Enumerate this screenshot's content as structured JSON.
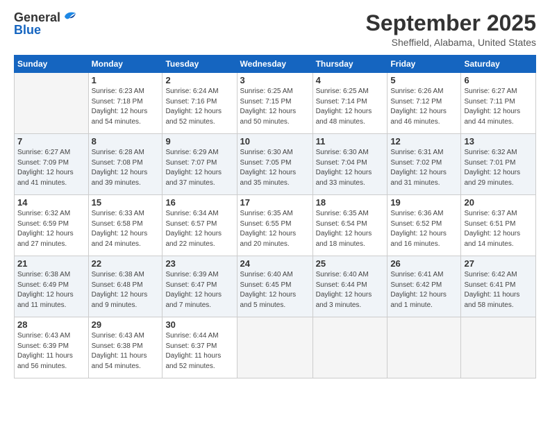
{
  "header": {
    "logo_general": "General",
    "logo_blue": "Blue",
    "month": "September 2025",
    "location": "Sheffield, Alabama, United States"
  },
  "weekdays": [
    "Sunday",
    "Monday",
    "Tuesday",
    "Wednesday",
    "Thursday",
    "Friday",
    "Saturday"
  ],
  "weeks": [
    [
      {
        "day": "",
        "empty": true
      },
      {
        "day": "1",
        "rise": "6:23 AM",
        "set": "7:18 PM",
        "hours": "12 hours and 54 minutes."
      },
      {
        "day": "2",
        "rise": "6:24 AM",
        "set": "7:16 PM",
        "hours": "12 hours and 52 minutes."
      },
      {
        "day": "3",
        "rise": "6:25 AM",
        "set": "7:15 PM",
        "hours": "12 hours and 50 minutes."
      },
      {
        "day": "4",
        "rise": "6:25 AM",
        "set": "7:14 PM",
        "hours": "12 hours and 48 minutes."
      },
      {
        "day": "5",
        "rise": "6:26 AM",
        "set": "7:12 PM",
        "hours": "12 hours and 46 minutes."
      },
      {
        "day": "6",
        "rise": "6:27 AM",
        "set": "7:11 PM",
        "hours": "12 hours and 44 minutes."
      }
    ],
    [
      {
        "day": "7",
        "rise": "6:27 AM",
        "set": "7:09 PM",
        "hours": "12 hours and 41 minutes."
      },
      {
        "day": "8",
        "rise": "6:28 AM",
        "set": "7:08 PM",
        "hours": "12 hours and 39 minutes."
      },
      {
        "day": "9",
        "rise": "6:29 AM",
        "set": "7:07 PM",
        "hours": "12 hours and 37 minutes."
      },
      {
        "day": "10",
        "rise": "6:30 AM",
        "set": "7:05 PM",
        "hours": "12 hours and 35 minutes."
      },
      {
        "day": "11",
        "rise": "6:30 AM",
        "set": "7:04 PM",
        "hours": "12 hours and 33 minutes."
      },
      {
        "day": "12",
        "rise": "6:31 AM",
        "set": "7:02 PM",
        "hours": "12 hours and 31 minutes."
      },
      {
        "day": "13",
        "rise": "6:32 AM",
        "set": "7:01 PM",
        "hours": "12 hours and 29 minutes."
      }
    ],
    [
      {
        "day": "14",
        "rise": "6:32 AM",
        "set": "6:59 PM",
        "hours": "12 hours and 27 minutes."
      },
      {
        "day": "15",
        "rise": "6:33 AM",
        "set": "6:58 PM",
        "hours": "12 hours and 24 minutes."
      },
      {
        "day": "16",
        "rise": "6:34 AM",
        "set": "6:57 PM",
        "hours": "12 hours and 22 minutes."
      },
      {
        "day": "17",
        "rise": "6:35 AM",
        "set": "6:55 PM",
        "hours": "12 hours and 20 minutes."
      },
      {
        "day": "18",
        "rise": "6:35 AM",
        "set": "6:54 PM",
        "hours": "12 hours and 18 minutes."
      },
      {
        "day": "19",
        "rise": "6:36 AM",
        "set": "6:52 PM",
        "hours": "12 hours and 16 minutes."
      },
      {
        "day": "20",
        "rise": "6:37 AM",
        "set": "6:51 PM",
        "hours": "12 hours and 14 minutes."
      }
    ],
    [
      {
        "day": "21",
        "rise": "6:38 AM",
        "set": "6:49 PM",
        "hours": "12 hours and 11 minutes."
      },
      {
        "day": "22",
        "rise": "6:38 AM",
        "set": "6:48 PM",
        "hours": "12 hours and 9 minutes."
      },
      {
        "day": "23",
        "rise": "6:39 AM",
        "set": "6:47 PM",
        "hours": "12 hours and 7 minutes."
      },
      {
        "day": "24",
        "rise": "6:40 AM",
        "set": "6:45 PM",
        "hours": "12 hours and 5 minutes."
      },
      {
        "day": "25",
        "rise": "6:40 AM",
        "set": "6:44 PM",
        "hours": "12 hours and 3 minutes."
      },
      {
        "day": "26",
        "rise": "6:41 AM",
        "set": "6:42 PM",
        "hours": "12 hours and 1 minute."
      },
      {
        "day": "27",
        "rise": "6:42 AM",
        "set": "6:41 PM",
        "hours": "11 hours and 58 minutes."
      }
    ],
    [
      {
        "day": "28",
        "rise": "6:43 AM",
        "set": "6:39 PM",
        "hours": "11 hours and 56 minutes."
      },
      {
        "day": "29",
        "rise": "6:43 AM",
        "set": "6:38 PM",
        "hours": "11 hours and 54 minutes."
      },
      {
        "day": "30",
        "rise": "6:44 AM",
        "set": "6:37 PM",
        "hours": "11 hours and 52 minutes."
      },
      {
        "day": "",
        "empty": true
      },
      {
        "day": "",
        "empty": true
      },
      {
        "day": "",
        "empty": true
      },
      {
        "day": "",
        "empty": true
      }
    ]
  ],
  "labels": {
    "sunrise": "Sunrise:",
    "sunset": "Sunset:",
    "daylight": "Daylight:"
  }
}
